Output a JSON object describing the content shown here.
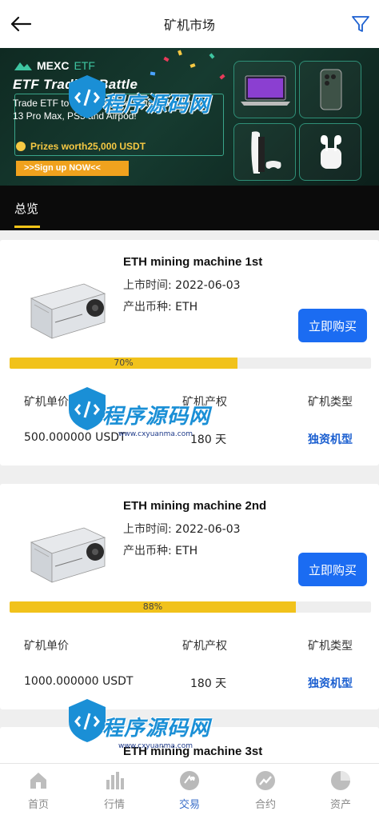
{
  "header": {
    "title": "矿机市场"
  },
  "banner": {
    "brand": "MEXC",
    "brand_suffix": "ETF",
    "headline": "ETF Trading Battle",
    "description": "Trade ETF to win Hardware Notebook, iPhone 13 Pro Max, PS5 and Airpod!",
    "prize": "Prizes worth25,000 USDT",
    "cta": ">>Sign up NOW<<"
  },
  "tabs": {
    "overview": "总览"
  },
  "labels": {
    "listed_time": "上市时间:",
    "output_coin": "产出币种:",
    "unit_price": "矿机单价",
    "ownership": "矿机产权",
    "type": "矿机类型",
    "buy": "立即购买"
  },
  "machines": [
    {
      "name": "ETH mining machine 1st",
      "date": "2022-06-03",
      "coin": "ETH",
      "progress": 0.7,
      "progress_text": "70%",
      "price": "500.000000 USDT",
      "term": "180 天",
      "type": "独资机型"
    },
    {
      "name": "ETH mining machine 2nd",
      "date": "2022-06-03",
      "coin": "ETH",
      "progress": 0.88,
      "progress_text": "88%",
      "price": "1000.000000 USDT",
      "term": "180 天",
      "type": "独资机型"
    },
    {
      "name": "ETH mining machine 3st"
    }
  ],
  "nav": [
    {
      "label": "首页",
      "icon": "home-icon"
    },
    {
      "label": "行情",
      "icon": "chart-bars-icon"
    },
    {
      "label": "交易",
      "icon": "trade-icon"
    },
    {
      "label": "合约",
      "icon": "contract-icon"
    },
    {
      "label": "资产",
      "icon": "pie-icon"
    }
  ],
  "watermark": {
    "text": "程序源码网",
    "url": "www.cxyuanma.com"
  },
  "colors": {
    "accent": "#1b6cf2",
    "progress": "#f1c21b",
    "active_nav": "#3b6fc9",
    "type_text": "#1b5fd0"
  }
}
